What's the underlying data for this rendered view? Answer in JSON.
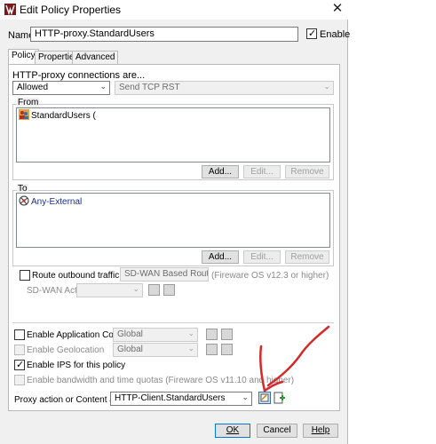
{
  "window": {
    "title": "Edit Policy Properties",
    "close_glyph": "✕"
  },
  "name_row": {
    "label": "Name:",
    "value": "HTTP-proxy.StandardUsers",
    "enable_label": "Enable",
    "enable_checked": true
  },
  "tabs": [
    {
      "label": "Policy"
    },
    {
      "label": "Properties"
    },
    {
      "label": "Advanced"
    }
  ],
  "policy": {
    "connections_label": "HTTP-proxy connections are...",
    "connections_value": "Allowed",
    "tcp_rst_value": "Send TCP RST",
    "from": {
      "title": "From",
      "items": [
        {
          "label": "StandardUsers (",
          "icon": "users-group-icon"
        }
      ],
      "buttons": {
        "add": "Add...",
        "edit": "Edit...",
        "remove": "Remove"
      }
    },
    "to": {
      "title": "To",
      "items": [
        {
          "label": "Any-External",
          "icon": "network-alias-icon"
        }
      ],
      "buttons": {
        "add": "Add...",
        "edit": "Edit...",
        "remove": "Remove"
      }
    },
    "route": {
      "label": "Route outbound traffic using",
      "value": "SD-WAN Based Routing",
      "note": "(Fireware OS v12.3 or higher)",
      "sdwan_label": "SD-WAN Action",
      "sdwan_value": ""
    },
    "app_control": {
      "label": "Enable Application Control:",
      "value": "Global",
      "checked": false
    },
    "geolocation": {
      "label": "Enable Geolocation",
      "value": "Global",
      "checked": false
    },
    "ips": {
      "label": "Enable IPS for this policy",
      "checked": true
    },
    "quota": {
      "label": "Enable bandwidth and time quotas (Fireware OS v11.10 and higher)",
      "checked": false
    },
    "proxy_action": {
      "label": "Proxy action or Content action:",
      "value": "HTTP-Client.StandardUsers"
    }
  },
  "footer": {
    "ok": "OK",
    "cancel": "Cancel",
    "help": "Help"
  },
  "colors": {
    "annotation": "#d42a2a",
    "accent": "#0078d7"
  }
}
